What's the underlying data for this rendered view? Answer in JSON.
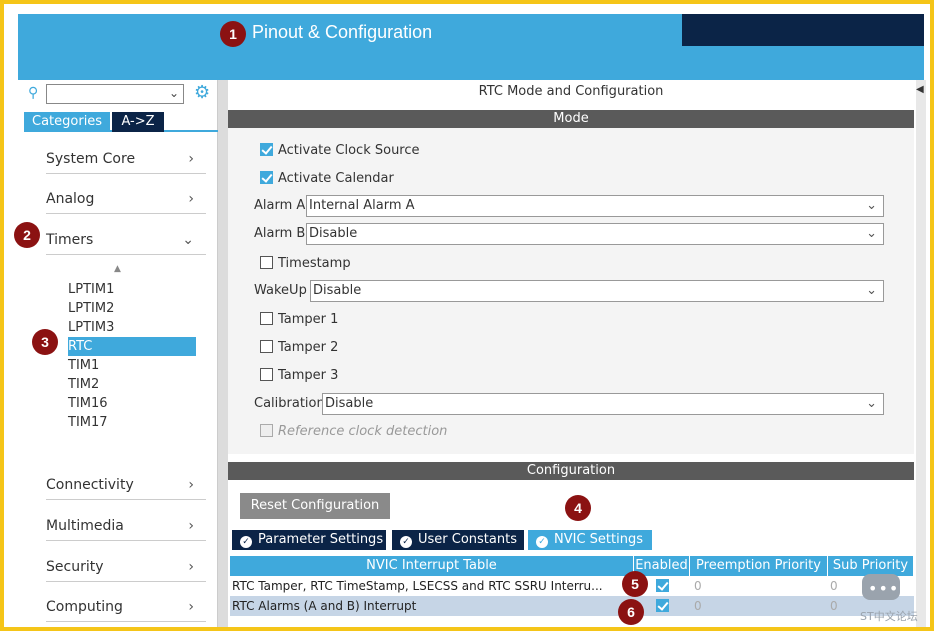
{
  "header": {
    "title": "Pinout & Configuration"
  },
  "badges": [
    "1",
    "2",
    "3",
    "4",
    "5",
    "6"
  ],
  "sidebar": {
    "tabs": [
      "Categories",
      "A->Z"
    ],
    "categories": [
      {
        "label": "System Core"
      },
      {
        "label": "Analog"
      },
      {
        "label": "Timers"
      },
      {
        "label": "Connectivity"
      },
      {
        "label": "Multimedia"
      },
      {
        "label": "Security"
      },
      {
        "label": "Computing"
      }
    ],
    "timers": [
      "LPTIM1",
      "LPTIM2",
      "LPTIM3",
      "RTC",
      "TIM1",
      "TIM2",
      "TIM16",
      "TIM17"
    ],
    "selected_timer": "RTC"
  },
  "panel": {
    "title": "RTC Mode and Configuration",
    "mode_label": "Mode",
    "activate_clock_source": "Activate Clock Source",
    "activate_calendar": "Activate Calendar",
    "alarm_a_label": "Alarm A",
    "alarm_a_value": "Internal Alarm A",
    "alarm_b_label": "Alarm B",
    "alarm_b_value": "Disable",
    "timestamp": "Timestamp",
    "wakeup_label": "WakeUp",
    "wakeup_value": "Disable",
    "tamper1": "Tamper 1",
    "tamper2": "Tamper 2",
    "tamper3": "Tamper 3",
    "calibration_label": "Calibration",
    "calibration_value": "Disable",
    "ref_clock": "Reference clock detection",
    "config_label": "Configuration",
    "reset_button": "Reset Configuration",
    "tabs": [
      "Parameter Settings",
      "User Constants",
      "NVIC Settings"
    ],
    "table": {
      "headers": [
        "NVIC Interrupt Table",
        "Enabled",
        "Preemption Priority",
        "Sub Priority"
      ],
      "rows": [
        {
          "name": "RTC Tamper, RTC TimeStamp, LSECSS and RTC SSRU Interru...",
          "preemption": "0",
          "sub": "0"
        },
        {
          "name": "RTC Alarms (A and B) Interrupt",
          "preemption": "0",
          "sub": "0"
        }
      ]
    }
  },
  "watermark": "ST中文论坛"
}
